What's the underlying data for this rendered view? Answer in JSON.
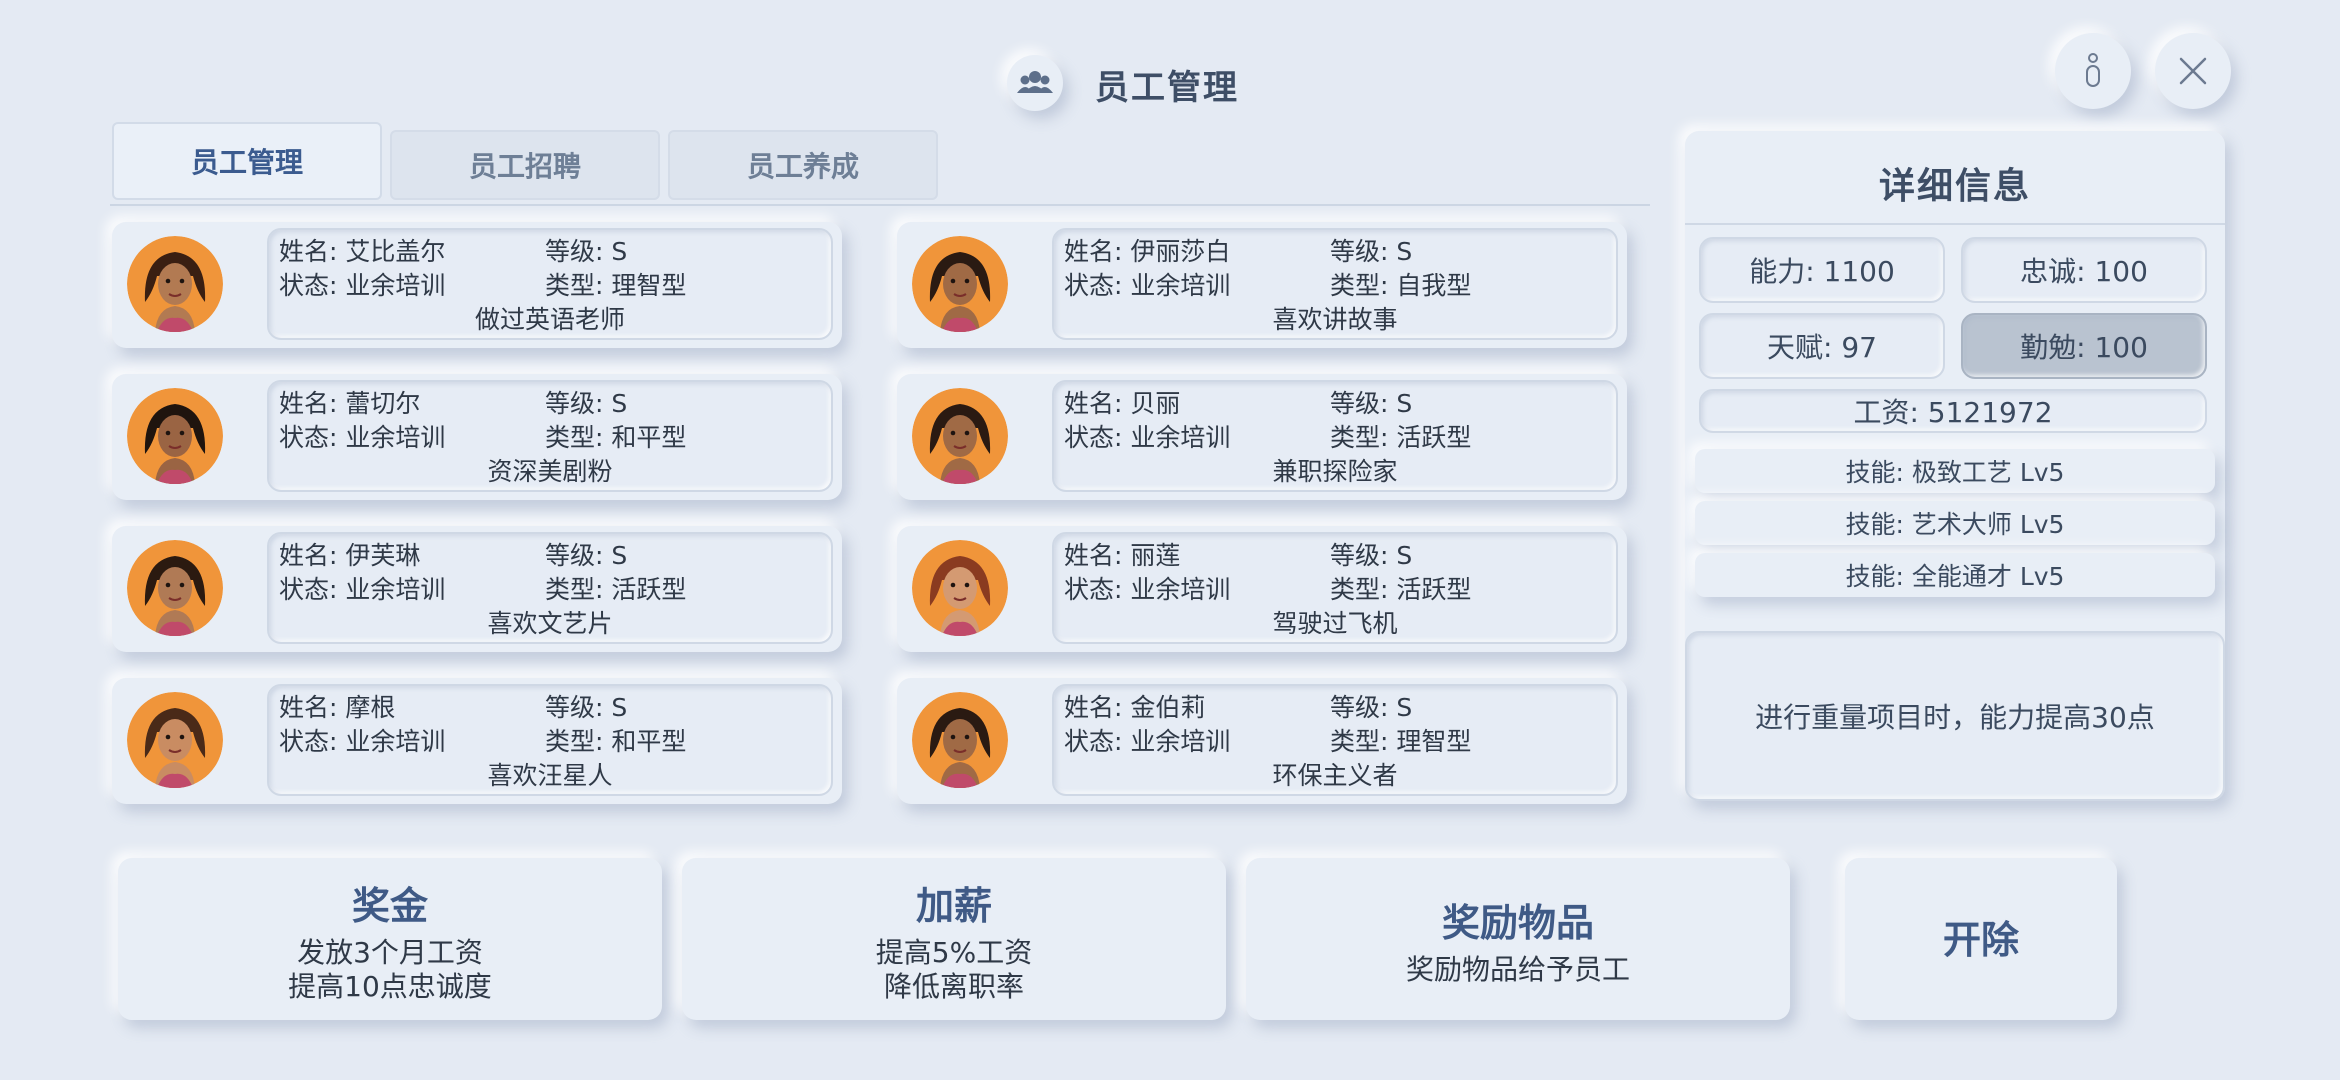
{
  "header": {
    "title": "员工管理",
    "icon": "group-icon",
    "info_icon": "info-icon",
    "close_icon": "close-icon"
  },
  "tabs": [
    {
      "label": "员工管理",
      "active": true
    },
    {
      "label": "员工招聘",
      "active": false
    },
    {
      "label": "员工养成",
      "active": false
    }
  ],
  "labels": {
    "name": "姓名: ",
    "level": "等级: ",
    "status": "状态: ",
    "type": "类型: "
  },
  "employees": [
    {
      "name": "艾比盖尔",
      "level": "S",
      "status": "业余培训",
      "type": "理智型",
      "note": "做过英语老师"
    },
    {
      "name": "伊丽莎白",
      "level": "S",
      "status": "业余培训",
      "type": "自我型",
      "note": "喜欢讲故事"
    },
    {
      "name": "蕾切尔",
      "level": "S",
      "status": "业余培训",
      "type": "和平型",
      "note": "资深美剧粉"
    },
    {
      "name": "贝丽",
      "level": "S",
      "status": "业余培训",
      "type": "活跃型",
      "note": "兼职探险家"
    },
    {
      "name": "伊芙琳",
      "level": "S",
      "status": "业余培训",
      "type": "活跃型",
      "note": "喜欢文艺片"
    },
    {
      "name": "丽莲",
      "level": "S",
      "status": "业余培训",
      "type": "活跃型",
      "note": "驾驶过飞机"
    },
    {
      "name": "摩根",
      "level": "S",
      "status": "业余培训",
      "type": "和平型",
      "note": "喜欢汪星人"
    },
    {
      "name": "金伯莉",
      "level": "S",
      "status": "业余培训",
      "type": "理智型",
      "note": "环保主义者"
    }
  ],
  "detail": {
    "title": "详细信息",
    "ability": "能力: 1100",
    "loyalty": "忠诚: 100",
    "talent": "天赋: 97",
    "diligence": "勤勉: 100",
    "salary": "工资: 5121972",
    "skills": [
      "技能: 极致工艺  Lv5",
      "技能: 艺术大师  Lv5",
      "技能: 全能通才  Lv5"
    ],
    "effect": "进行重量项目时，能力提高30点"
  },
  "actions": {
    "bonus": {
      "title": "奖金",
      "line1": "发放3个月工资",
      "line2": "提高10点忠诚度"
    },
    "raise": {
      "title": "加薪",
      "line1": "提高5%工资",
      "line2": "降低离职率"
    },
    "reward": {
      "title": "奖励物品",
      "line1": "奖励物品给予员工"
    },
    "fire": {
      "title": "开除"
    }
  },
  "colors": {
    "background": "#e4eaf3",
    "accent": "#3f5a86",
    "avatar_bg": "#f0953a"
  }
}
